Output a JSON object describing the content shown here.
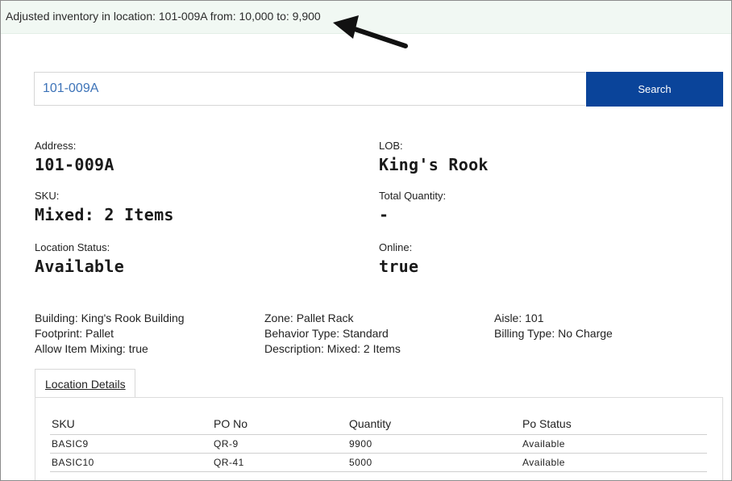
{
  "banner": {
    "message": "Adjusted inventory in location: 101-009A from: 10,000 to: 9,900"
  },
  "search": {
    "value": "101-009A",
    "button_label": "Search"
  },
  "summary": {
    "address_label": "Address:",
    "address_value": "101-009A",
    "lob_label": "LOB:",
    "lob_value": "King's Rook",
    "sku_label": "SKU:",
    "sku_value": "Mixed: 2 Items",
    "total_qty_label": "Total Quantity:",
    "total_qty_value": "-",
    "status_label": "Location Status:",
    "status_value": "Available",
    "online_label": "Online:",
    "online_value": "true"
  },
  "details": {
    "building": "Building: King's Rook Building",
    "footprint": "Footprint: Pallet",
    "allow_mixing": "Allow Item Mixing: true",
    "zone": "Zone: Pallet Rack",
    "behavior": "Behavior Type: Standard",
    "description": "Description: Mixed: 2 Items",
    "aisle": "Aisle: 101",
    "billing": "Billing Type: No Charge"
  },
  "tabs": [
    {
      "label": "Location Details"
    }
  ],
  "table": {
    "headers": [
      "SKU",
      "PO No",
      "Quantity",
      "Po Status"
    ],
    "rows": [
      [
        "BASIC9",
        "QR-9",
        "9900",
        "Available"
      ],
      [
        "BASIC10",
        "QR-41",
        "5000",
        "Available"
      ]
    ]
  },
  "colors": {
    "accent": "#0a449a",
    "banner_bg": "#f1f8f3",
    "input_text": "#3d73b8"
  }
}
